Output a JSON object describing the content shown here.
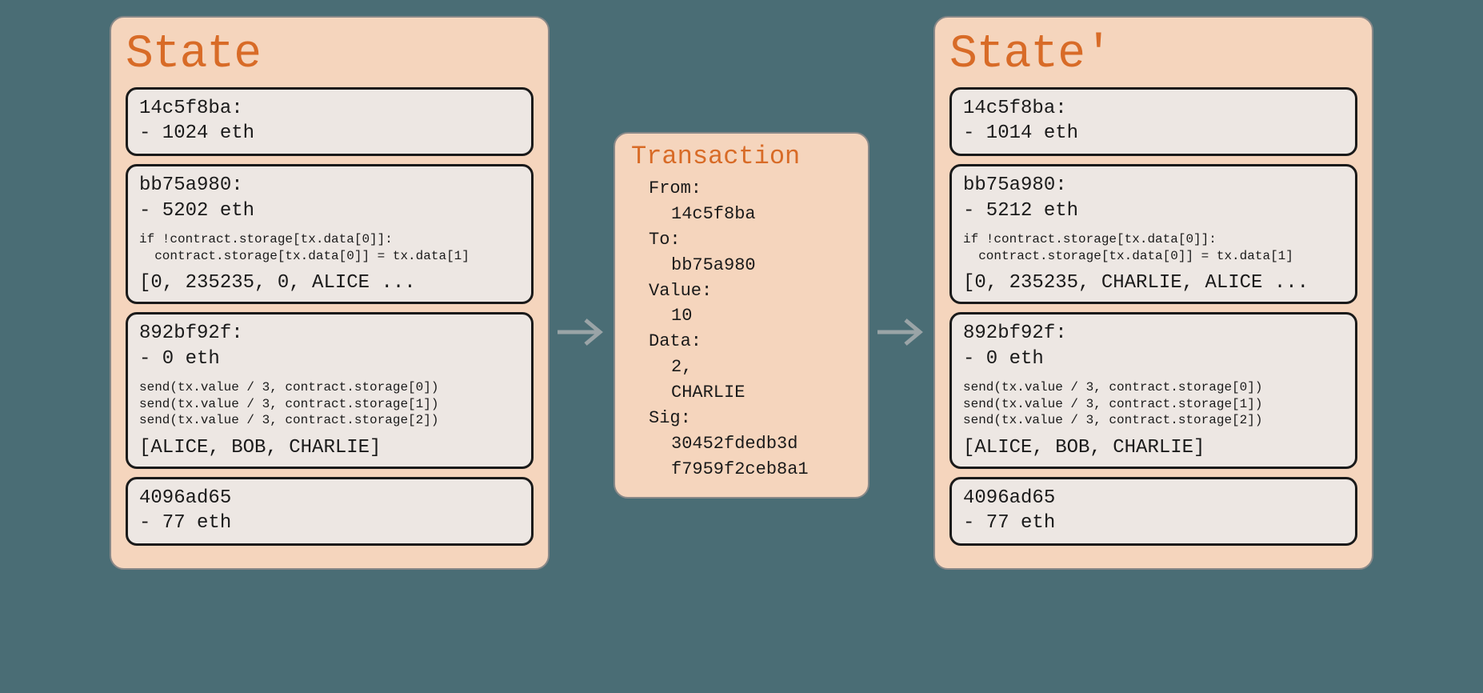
{
  "state_before": {
    "title": "State",
    "accounts": [
      {
        "address": "14c5f8ba:",
        "balance": "- 1024 eth",
        "code": null,
        "storage": null
      },
      {
        "address": "bb75a980:",
        "balance": "- 5202 eth",
        "code": "if !contract.storage[tx.data[0]]:\n  contract.storage[tx.data[0]] = tx.data[1]",
        "storage": "[0, 235235, 0, ALICE ..."
      },
      {
        "address": "892bf92f:",
        "balance": "- 0 eth",
        "code": "send(tx.value / 3, contract.storage[0])\nsend(tx.value / 3, contract.storage[1])\nsend(tx.value / 3, contract.storage[2])",
        "storage": "[ALICE, BOB, CHARLIE]"
      },
      {
        "address": "4096ad65",
        "balance": "- 77 eth",
        "code": null,
        "storage": null
      }
    ]
  },
  "transaction": {
    "title": "Transaction",
    "from_label": "From:",
    "from": "14c5f8ba",
    "to_label": "To:",
    "to": "bb75a980",
    "value_label": "Value:",
    "value": "10",
    "data_label": "Data:",
    "data1": "2,",
    "data2": "CHARLIE",
    "sig_label": "Sig:",
    "sig1": "30452fdedb3d",
    "sig2": "f7959f2ceb8a1"
  },
  "state_after": {
    "title": "State'",
    "accounts": [
      {
        "address": "14c5f8ba:",
        "balance": "- 1014 eth",
        "code": null,
        "storage": null
      },
      {
        "address": "bb75a980:",
        "balance": "- 5212 eth",
        "code": "if !contract.storage[tx.data[0]]:\n  contract.storage[tx.data[0]] = tx.data[1]",
        "storage": "[0, 235235, CHARLIE, ALICE ..."
      },
      {
        "address": "892bf92f:",
        "balance": "- 0 eth",
        "code": "send(tx.value / 3, contract.storage[0])\nsend(tx.value / 3, contract.storage[1])\nsend(tx.value / 3, contract.storage[2])",
        "storage": "[ALICE, BOB, CHARLIE]"
      },
      {
        "address": "4096ad65",
        "balance": "- 77 eth",
        "code": null,
        "storage": null
      }
    ]
  }
}
